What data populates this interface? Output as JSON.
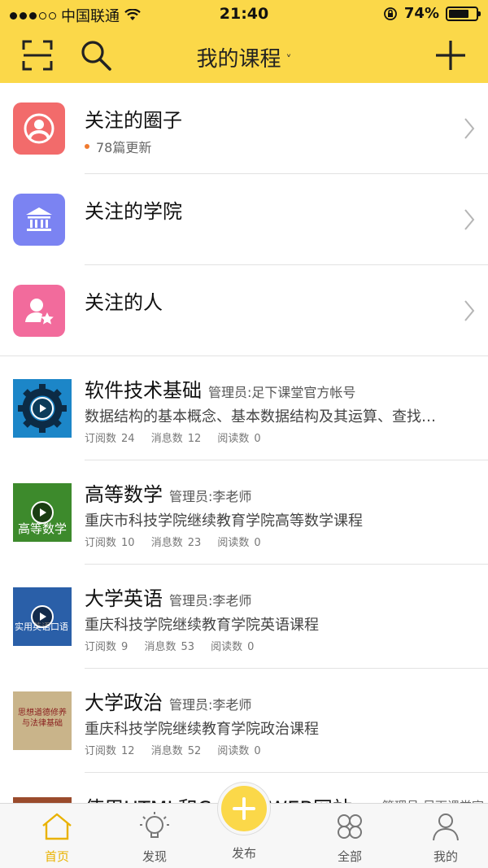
{
  "status_bar": {
    "carrier": "中国联通",
    "time": "21:40",
    "battery_percent": "74%",
    "battery_level": 0.74
  },
  "nav": {
    "title": "我的课程",
    "title_chevron": "˅",
    "icons": [
      "scan-icon",
      "search-icon",
      "plus-icon"
    ]
  },
  "follow_items": [
    {
      "title": "关注的圈子",
      "sub": "78篇更新",
      "color": "#f26b6b",
      "icon": "circle-people-icon"
    },
    {
      "title": "关注的学院",
      "sub": "",
      "color": "#7b83f2",
      "icon": "building-icon"
    },
    {
      "title": "关注的人",
      "sub": "",
      "color": "#f26b9c",
      "icon": "person-star-icon"
    }
  ],
  "courses": [
    {
      "name": "软件技术基础",
      "admin": "管理员:足下课堂官方帐号",
      "desc": "数据结构的基本概念、基本数据结构及其运算、查找…",
      "subs_label": "订阅数",
      "subs": "24",
      "msgs_label": "消息数",
      "msgs": "12",
      "reads_label": "阅读数",
      "reads": "0",
      "cover_color": "#1c86c8"
    },
    {
      "name": "高等数学",
      "admin": "管理员:李老师",
      "desc": "重庆市科技学院继续教育学院高等数学课程",
      "subs_label": "订阅数",
      "subs": "10",
      "msgs_label": "消息数",
      "msgs": "23",
      "reads_label": "阅读数",
      "reads": "0",
      "cover_color": "#3d8a2c",
      "cover_text": "高等数学"
    },
    {
      "name": "大学英语",
      "admin": "管理员:李老师",
      "desc": "重庆科技学院继续教育学院英语课程",
      "subs_label": "订阅数",
      "subs": "9",
      "msgs_label": "消息数",
      "msgs": "53",
      "reads_label": "阅读数",
      "reads": "0",
      "cover_color": "#2a5fa8",
      "cover_text": "实用英语口语"
    },
    {
      "name": "大学政治",
      "admin": "管理员:李老师",
      "desc": "重庆科技学院继续教育学院政治课程",
      "subs_label": "订阅数",
      "subs": "12",
      "msgs_label": "消息数",
      "msgs": "52",
      "reads_label": "阅读数",
      "reads": "0",
      "cover_color": "#c9b48a",
      "cover_text": "思想道德修养与法律基础"
    }
  ],
  "peek_course": {
    "name": "使用HTML和C",
    "name_tail": "WEB网站",
    "admin": "管理员:足下课堂官"
  },
  "tabs": [
    {
      "label": "首页",
      "icon": "home-icon",
      "active": true
    },
    {
      "label": "发现",
      "icon": "lightbulb-icon",
      "active": false
    },
    {
      "label": "发布",
      "icon": "plus-icon",
      "active": false
    },
    {
      "label": "全部",
      "icon": "grid-icon",
      "active": false
    },
    {
      "label": "我的",
      "icon": "user-icon",
      "active": false
    }
  ],
  "colors": {
    "accent": "#fbd849",
    "active_tab": "#e9b200",
    "update_dot": "#f07a2f"
  }
}
